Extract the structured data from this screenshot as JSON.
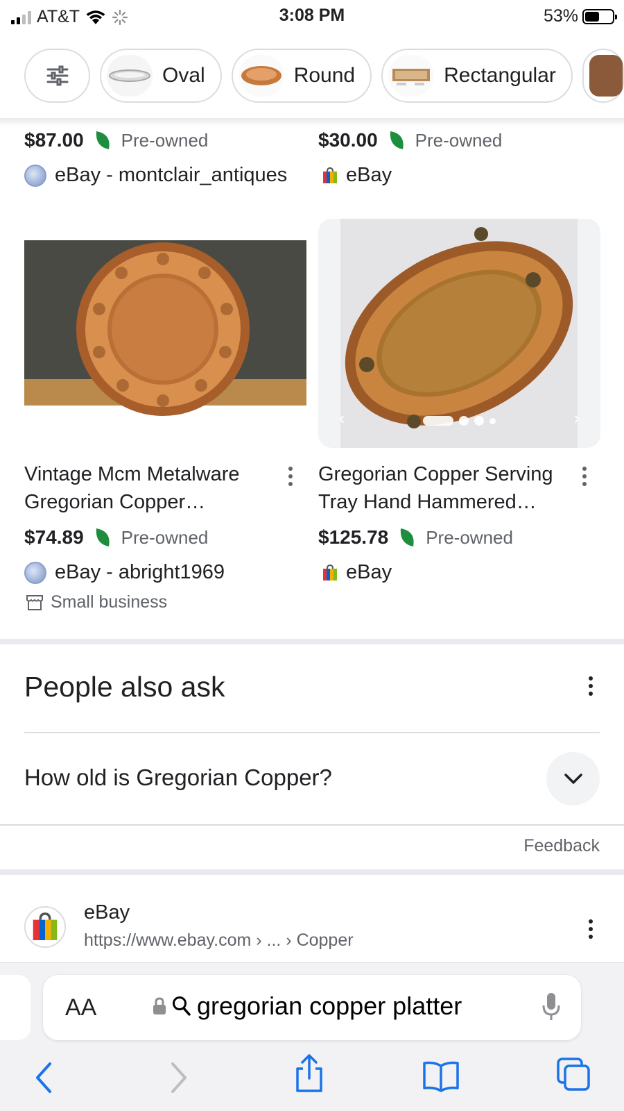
{
  "status_bar": {
    "carrier": "AT&T",
    "time": "3:08 PM",
    "battery": "53%"
  },
  "chips": [
    {
      "label": "Oval"
    },
    {
      "label": "Round"
    },
    {
      "label": "Rectangular"
    }
  ],
  "top_products": [
    {
      "price": "$87.00",
      "condition": "Pre-owned",
      "seller": "eBay - montclair_antiques"
    },
    {
      "price": "$30.00",
      "condition": "Pre-owned",
      "seller": "eBay"
    }
  ],
  "products": [
    {
      "title_line1": "Vintage Mcm Metalware",
      "title_line2": "Gregorian Copper…",
      "price": "$74.89",
      "condition": "Pre-owned",
      "seller": "eBay - abright1969",
      "badge": "Small business"
    },
    {
      "title_line1": "Gregorian Copper Serving",
      "title_line2": "Tray Hand Hammered…",
      "price": "$125.78",
      "condition": "Pre-owned",
      "seller": "eBay"
    }
  ],
  "people_also_ask": {
    "heading": "People also ask",
    "questions": [
      "How old is Gregorian Copper?"
    ],
    "feedback": "Feedback"
  },
  "result": {
    "site": "eBay",
    "url": "https://www.ebay.com › ... › Copper"
  },
  "browser": {
    "aa": "AA",
    "query": "gregorian copper platter"
  },
  "colors": {
    "leaf": "#1e8e3e",
    "copper": "#c57a3c",
    "text": "#202124",
    "secondary": "#5f6368",
    "ios_blue": "#1a73e8"
  }
}
